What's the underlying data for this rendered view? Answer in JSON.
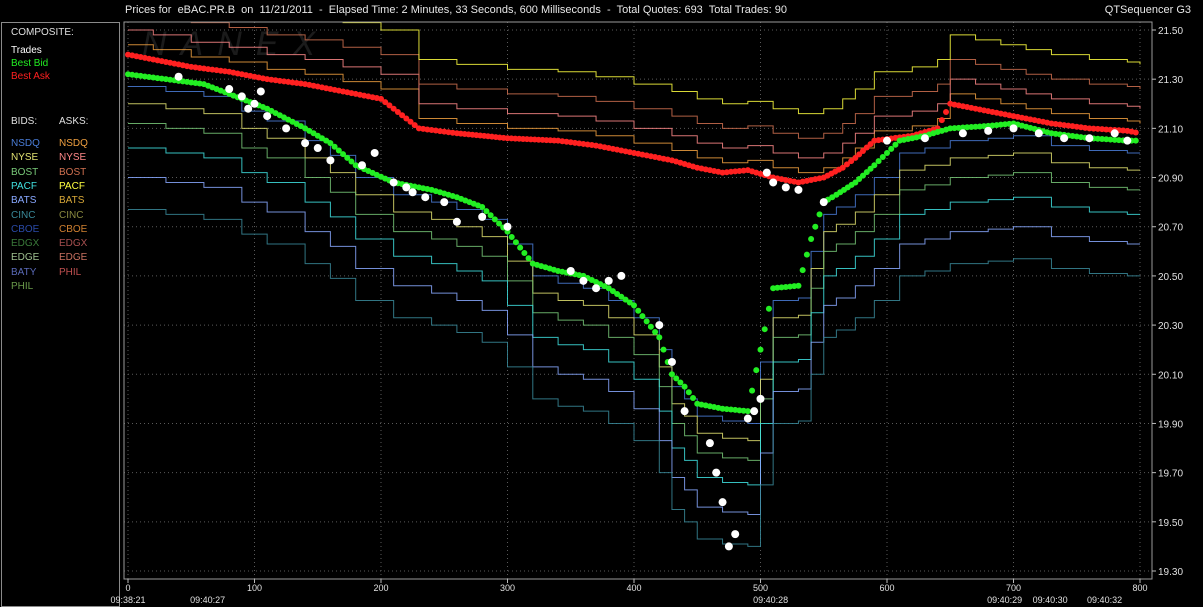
{
  "header": {
    "title": "Prices for  eBAC.PR.B  on  11/21/2011  -  Elapsed Time: 2 Minutes, 33 Seconds, 600 Milliseconds  -  Total Quotes: 693  Total Trades: 90",
    "app": "QTSequencer G3"
  },
  "watermark": "NANEX",
  "legend": {
    "composite_label": "COMPOSITE:",
    "composite": [
      {
        "label": "Trades",
        "color": "#ffffff"
      },
      {
        "label": "Best Bid",
        "color": "#22ee22"
      },
      {
        "label": "Best Ask",
        "color": "#ff2020"
      }
    ],
    "bids_label": "BIDS:",
    "asks_label": "ASKS:",
    "bids": [
      {
        "label": "NSDQ",
        "color": "#4a7dd8"
      },
      {
        "label": "NYSE",
        "color": "#e0e070"
      },
      {
        "label": "BOST",
        "color": "#78c878"
      },
      {
        "label": "PACF",
        "color": "#40e0e0"
      },
      {
        "label": "BATS",
        "color": "#88a8ff"
      },
      {
        "label": "CINC",
        "color": "#3a8a9a"
      },
      {
        "label": "CBOE",
        "color": "#2a4aa8"
      },
      {
        "label": "EDGX",
        "color": "#3a7a3a"
      },
      {
        "label": "EDGE",
        "color": "#a0c090"
      },
      {
        "label": "BATY",
        "color": "#5a6ab8"
      },
      {
        "label": "PHIL",
        "color": "#6a9a4a"
      }
    ],
    "asks": [
      {
        "label": "NSDQ",
        "color": "#f0a040"
      },
      {
        "label": "NYSE",
        "color": "#ff8888"
      },
      {
        "label": "BOST",
        "color": "#d07050"
      },
      {
        "label": "PACF",
        "color": "#ffff40"
      },
      {
        "label": "BATS",
        "color": "#d8a838"
      },
      {
        "label": "CINC",
        "color": "#8a8a40"
      },
      {
        "label": "CBOE",
        "color": "#d08030"
      },
      {
        "label": "EDGX",
        "color": "#a85050"
      },
      {
        "label": "EDGE",
        "color": "#c87060"
      },
      {
        "label": "PHIL",
        "color": "#c05050"
      }
    ]
  },
  "chart_data": {
    "type": "scatter",
    "xlim": [
      0,
      800
    ],
    "ylim": [
      19.3,
      21.5
    ],
    "x_ticks": [
      0,
      100,
      200,
      300,
      400,
      500,
      600,
      700,
      800
    ],
    "y_ticks": [
      "19.30",
      "19.50",
      "19.70",
      "19.90",
      "20.10",
      "20.30",
      "20.50",
      "20.70",
      "20.90",
      "21.10",
      "21.30",
      "21.50"
    ],
    "time_labels": [
      {
        "x": 0,
        "label": "09:38:21"
      },
      {
        "x": 63,
        "label": "09:40:27"
      },
      {
        "x": 508,
        "label": "09:40:28"
      },
      {
        "x": 693,
        "label": "09:40:29"
      },
      {
        "x": 729,
        "label": "09:40:30"
      },
      {
        "x": 772,
        "label": "09:40:32"
      }
    ],
    "series": [
      {
        "name": "Best Ask",
        "color": "#ff2020",
        "points": [
          [
            0,
            21.4
          ],
          [
            20,
            21.38
          ],
          [
            50,
            21.35
          ],
          [
            80,
            21.33
          ],
          [
            110,
            21.3
          ],
          [
            140,
            21.28
          ],
          [
            170,
            21.25
          ],
          [
            200,
            21.22
          ],
          [
            230,
            21.1
          ],
          [
            260,
            21.08
          ],
          [
            300,
            21.06
          ],
          [
            340,
            21.05
          ],
          [
            370,
            21.03
          ],
          [
            400,
            21.0
          ],
          [
            430,
            20.97
          ],
          [
            450,
            20.94
          ],
          [
            470,
            20.92
          ],
          [
            490,
            20.93
          ],
          [
            510,
            20.9
          ],
          [
            530,
            20.88
          ],
          [
            550,
            20.9
          ],
          [
            565,
            20.94
          ],
          [
            575,
            20.98
          ],
          [
            590,
            21.05
          ],
          [
            620,
            21.07
          ],
          [
            640,
            21.1
          ],
          [
            650,
            21.2
          ],
          [
            670,
            21.18
          ],
          [
            690,
            21.16
          ],
          [
            710,
            21.14
          ],
          [
            730,
            21.12
          ],
          [
            760,
            21.1
          ],
          [
            790,
            21.09
          ],
          [
            800,
            21.08
          ]
        ]
      },
      {
        "name": "Best Bid",
        "color": "#22ee22",
        "points": [
          [
            0,
            21.32
          ],
          [
            30,
            21.3
          ],
          [
            60,
            21.28
          ],
          [
            90,
            21.22
          ],
          [
            110,
            21.18
          ],
          [
            140,
            21.1
          ],
          [
            160,
            21.04
          ],
          [
            180,
            20.95
          ],
          [
            210,
            20.88
          ],
          [
            240,
            20.85
          ],
          [
            260,
            20.82
          ],
          [
            280,
            20.78
          ],
          [
            300,
            20.68
          ],
          [
            320,
            20.55
          ],
          [
            340,
            20.52
          ],
          [
            360,
            20.5
          ],
          [
            380,
            20.45
          ],
          [
            400,
            20.38
          ],
          [
            420,
            20.25
          ],
          [
            430,
            20.1
          ],
          [
            440,
            20.05
          ],
          [
            450,
            19.98
          ],
          [
            470,
            19.96
          ],
          [
            490,
            19.95
          ],
          [
            500,
            20.2
          ],
          [
            510,
            20.45
          ],
          [
            530,
            20.46
          ],
          [
            540,
            20.65
          ],
          [
            550,
            20.8
          ],
          [
            560,
            20.83
          ],
          [
            575,
            20.88
          ],
          [
            590,
            20.95
          ],
          [
            610,
            21.05
          ],
          [
            630,
            21.07
          ],
          [
            650,
            21.1
          ],
          [
            680,
            21.11
          ],
          [
            700,
            21.12
          ],
          [
            730,
            21.08
          ],
          [
            760,
            21.06
          ],
          [
            790,
            21.05
          ],
          [
            800,
            21.05
          ]
        ]
      },
      {
        "name": "Trades",
        "color": "#ffffff",
        "points": [
          [
            40,
            21.31
          ],
          [
            80,
            21.26
          ],
          [
            90,
            21.23
          ],
          [
            95,
            21.18
          ],
          [
            100,
            21.2
          ],
          [
            105,
            21.25
          ],
          [
            110,
            21.15
          ],
          [
            125,
            21.1
          ],
          [
            140,
            21.04
          ],
          [
            150,
            21.02
          ],
          [
            160,
            20.97
          ],
          [
            185,
            20.95
          ],
          [
            195,
            21.0
          ],
          [
            210,
            20.88
          ],
          [
            220,
            20.86
          ],
          [
            225,
            20.84
          ],
          [
            235,
            20.82
          ],
          [
            250,
            20.8
          ],
          [
            260,
            20.72
          ],
          [
            280,
            20.74
          ],
          [
            300,
            20.7
          ],
          [
            350,
            20.52
          ],
          [
            360,
            20.48
          ],
          [
            370,
            20.45
          ],
          [
            380,
            20.48
          ],
          [
            390,
            20.5
          ],
          [
            420,
            20.3
          ],
          [
            430,
            20.15
          ],
          [
            440,
            19.95
          ],
          [
            460,
            19.82
          ],
          [
            465,
            19.7
          ],
          [
            470,
            19.58
          ],
          [
            475,
            19.4
          ],
          [
            480,
            19.45
          ],
          [
            490,
            19.92
          ],
          [
            495,
            19.95
          ],
          [
            500,
            20.0
          ],
          [
            505,
            20.92
          ],
          [
            510,
            20.88
          ],
          [
            520,
            20.86
          ],
          [
            530,
            20.85
          ],
          [
            550,
            20.8
          ],
          [
            600,
            21.05
          ],
          [
            630,
            21.06
          ],
          [
            660,
            21.08
          ],
          [
            680,
            21.09
          ],
          [
            700,
            21.1
          ],
          [
            720,
            21.08
          ],
          [
            740,
            21.06
          ],
          [
            760,
            21.06
          ],
          [
            780,
            21.08
          ],
          [
            790,
            21.05
          ]
        ]
      }
    ]
  }
}
